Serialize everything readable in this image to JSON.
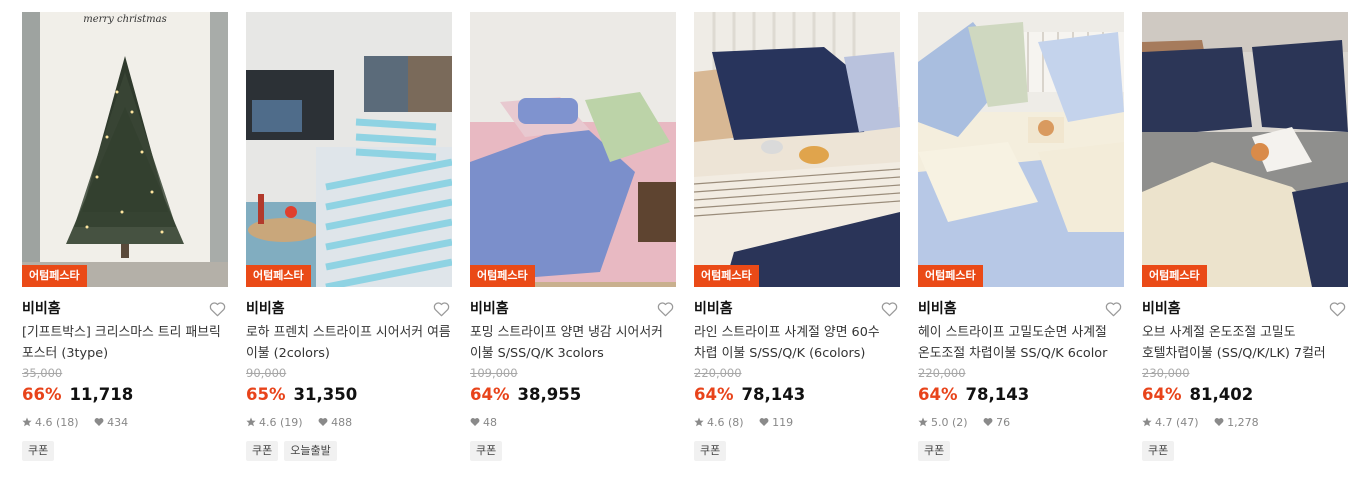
{
  "colors": {
    "badge": "#ea4a17",
    "discount": "#e8431a"
  },
  "products": [
    {
      "badge": "어텀페스타",
      "brand": "비비홈",
      "title": "[기프트박스] 크리스마스 트리 패브릭 포스터 (3type)",
      "original_price": "35,000",
      "discount": "66%",
      "price": "11,718",
      "rating": "4.6",
      "reviews": "(18)",
      "likes": "434",
      "tags": [
        "쿠폰"
      ],
      "image_art": {
        "script": "merry christmas"
      }
    },
    {
      "badge": "어텀페스타",
      "brand": "비비홈",
      "title": "로하 프렌치 스트라이프 시어서커 여름 이불 (2colors)",
      "original_price": "90,000",
      "discount": "65%",
      "price": "31,350",
      "rating": "4.6",
      "reviews": "(19)",
      "likes": "488",
      "tags": [
        "쿠폰",
        "오늘출발"
      ]
    },
    {
      "badge": "어텀페스타",
      "brand": "비비홈",
      "title": "포밍 스트라이프 양면 냉감 시어서커 이불 S/SS/Q/K 3colors",
      "original_price": "109,000",
      "discount": "64%",
      "price": "38,955",
      "rating": "",
      "reviews": "",
      "likes": "48",
      "tags": [
        "쿠폰"
      ]
    },
    {
      "badge": "어텀페스타",
      "brand": "비비홈",
      "title": "라인 스트라이프 사계절 양면 60수 차렵 이불 S/SS/Q/K (6colors)",
      "original_price": "220,000",
      "discount": "64%",
      "price": "78,143",
      "rating": "4.6",
      "reviews": "(8)",
      "likes": "119",
      "tags": [
        "쿠폰"
      ]
    },
    {
      "badge": "어텀페스타",
      "brand": "비비홈",
      "title": "헤이 스트라이프 고밀도순면 사계절 온도조절 차렵이불 SS/Q/K 6color",
      "original_price": "220,000",
      "discount": "64%",
      "price": "78,143",
      "rating": "5.0",
      "reviews": "(2)",
      "likes": "76",
      "tags": [
        "쿠폰"
      ]
    },
    {
      "badge": "어텀페스타",
      "brand": "비비홈",
      "title": "오브 사계절 온도조절 고밀도 호텔차렵이불 (SS/Q/K/LK) 7컬러",
      "original_price": "230,000",
      "discount": "64%",
      "price": "81,402",
      "rating": "4.7",
      "reviews": "(47)",
      "likes": "1,278",
      "tags": [
        "쿠폰"
      ]
    }
  ]
}
